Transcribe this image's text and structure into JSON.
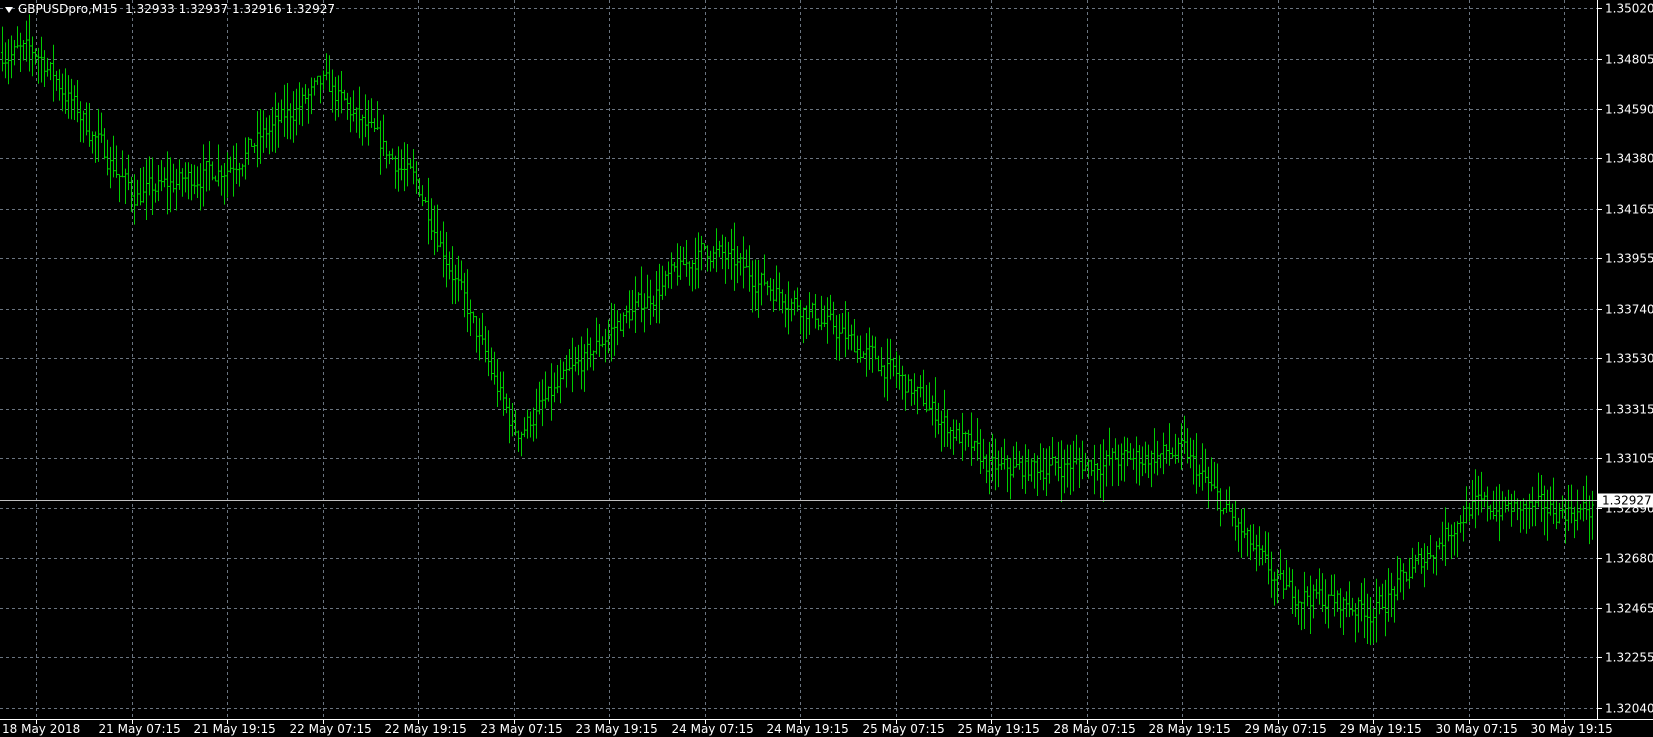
{
  "header": {
    "symbol": "GBPUSDpro,M15",
    "values": "1.32933 1.32937 1.32916 1.32927"
  },
  "colors": {
    "background": "#000000",
    "bars": "#00cc00",
    "grid": "#6a7480",
    "axis": "#ffffff",
    "text": "#ffffff"
  },
  "chart_data": {
    "type": "bar",
    "ylim": [
      1.2999,
      1.3507
    ],
    "y_ticks": [
      "1.35020",
      "1.34805",
      "1.34590",
      "1.34380",
      "1.34165",
      "1.33955",
      "1.33740",
      "1.33530",
      "1.33315",
      "1.33105",
      "1.32890",
      "1.32680",
      "1.32465",
      "1.32255",
      "1.32040"
    ],
    "x_ticks": [
      "18 May 2018",
      "21 May 07:15",
      "21 May 19:15",
      "22 May 07:15",
      "22 May 19:15",
      "23 May 07:15",
      "23 May 19:15",
      "24 May 07:15",
      "24 May 19:15",
      "25 May 07:15",
      "25 May 19:15",
      "28 May 07:15",
      "28 May 19:15",
      "29 May 07:15",
      "29 May 19:15",
      "30 May 07:15",
      "30 May 19:15"
    ],
    "current_price": "1.32927",
    "price_path": [
      {
        "t": "18 May 2018",
        "price": 1.3483
      },
      {
        "t": "21 May 07:15",
        "price": 1.3422
      },
      {
        "t": "21 May 19:15",
        "price": 1.3435
      },
      {
        "t": "22 May 07:15",
        "price": 1.347
      },
      {
        "t": "22 May 19:15",
        "price": 1.3425
      },
      {
        "t": "23 May 07:15",
        "price": 1.332
      },
      {
        "t": "23 May 19:15",
        "price": 1.3365
      },
      {
        "t": "24 May 07:15",
        "price": 1.34
      },
      {
        "t": "24 May 19:15",
        "price": 1.3375
      },
      {
        "t": "25 May 07:15",
        "price": 1.3345
      },
      {
        "t": "25 May 19:15",
        "price": 1.3305
      },
      {
        "t": "28 May 07:15",
        "price": 1.3308
      },
      {
        "t": "28 May 19:15",
        "price": 1.3313
      },
      {
        "t": "29 May 07:15",
        "price": 1.3255
      },
      {
        "t": "29 May 19:15",
        "price": 1.3245
      },
      {
        "t": "30 May 07:15",
        "price": 1.329
      },
      {
        "t": "30 May 19:15",
        "price": 1.3288
      }
    ]
  }
}
